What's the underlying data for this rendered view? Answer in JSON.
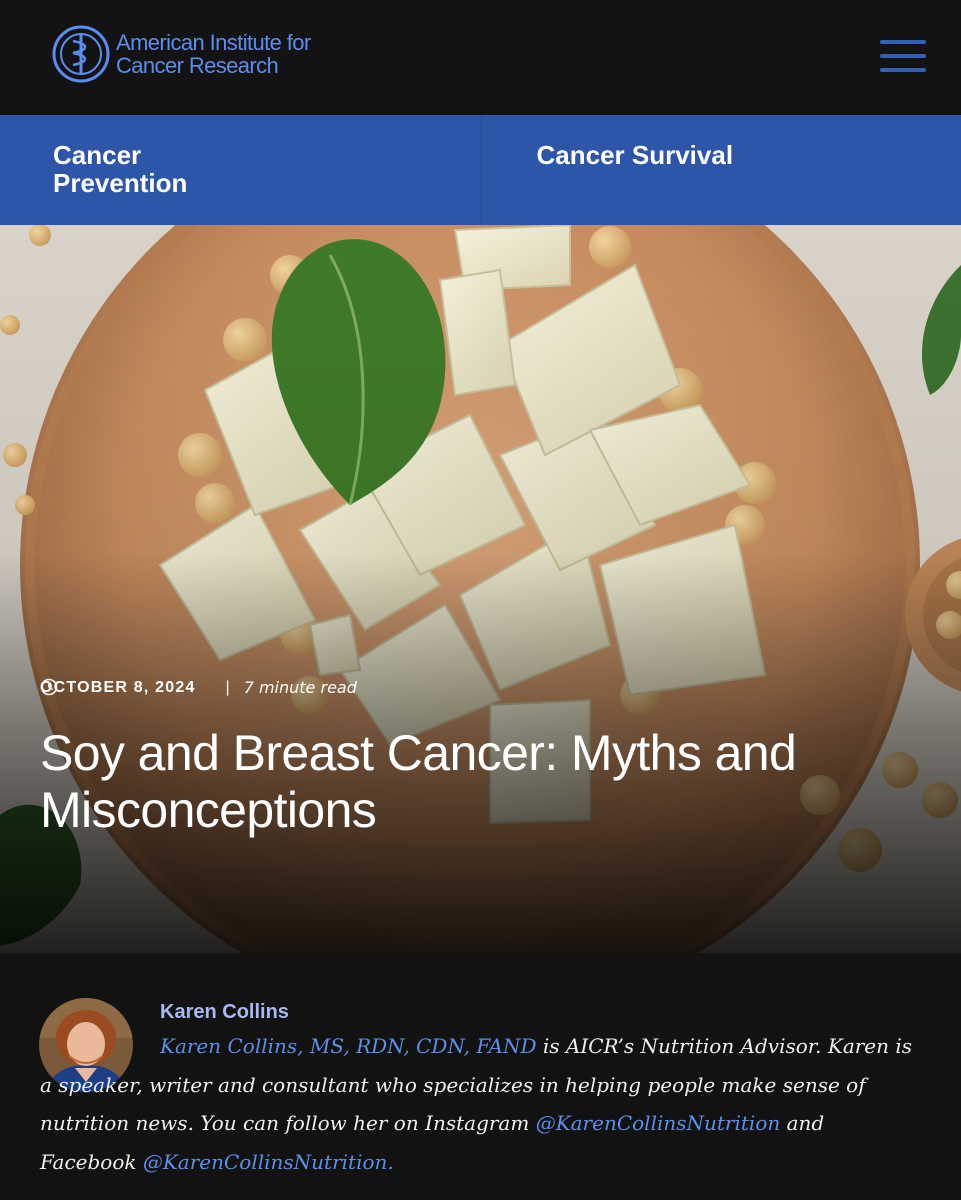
{
  "header": {
    "logo_line1": "American Institute for",
    "logo_line2": "Cancer Research",
    "menu_icon": "hamburger-menu-icon"
  },
  "nav": {
    "items": [
      {
        "label": "Cancer Prevention"
      },
      {
        "label": "Cancer Survival"
      }
    ]
  },
  "article": {
    "date": "OCTOBER 8, 2024",
    "separator": "|",
    "read_time": "7 minute read",
    "clock_icon": "clock-icon",
    "title": "Soy and Breast Cancer: Myths and Misconceptions"
  },
  "author": {
    "name": "Karen Collins",
    "credentials_link": "Karen Collins, MS, RDN, CDN, FAND",
    "bio_part1": " is AICR’s Nutrition Advisor. Karen is a speaker, writer and consultant who specializes in helping people make sense of nutrition news. You can follow her on Instagram ",
    "instagram_handle": "@KarenCollinsNutrition",
    "bio_part2": " and Facebook ",
    "facebook_handle": "@KarenCollinsNutrition."
  },
  "colors": {
    "header_bg": "#131313",
    "brand_blue": "#2d55a8",
    "logo_blue": "#5b8df0",
    "link_blue": "#5b8fe8",
    "author_name": "#a8b9f2"
  }
}
